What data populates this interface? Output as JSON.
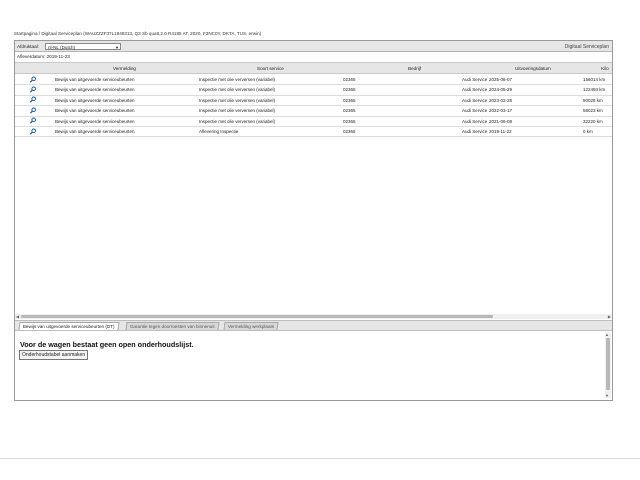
{
  "breadcrumb": "Startpagina / Digitaal Serviceplan (WAUZZZF37L1848313, Q3 Sb quatt,2.0 R4185 AT, 2020, F3NC0Y, DKTA, TUS, erwin)",
  "toolbar": {
    "language_label": "Afdruktaal:",
    "language_value": "nl-NL (Dutch)",
    "brand_label": "Digitaal Serviceplan"
  },
  "delivery_label": "Afleverdatum: 2019-11-23",
  "table": {
    "headers": [
      "Vermelding",
      "Soort service",
      "Bedrijf",
      "Uitvoeringsdatum",
      "Kilo"
    ],
    "rows": [
      {
        "icon": "magnifier-icon",
        "vermelding": "Bewijs van uitgevoerde serviceubeurten",
        "soort": "Inspectie met olie verversen (variabel)",
        "code": "02365",
        "bedrijf": "Audi Service",
        "datum": "2025-06-07",
        "km": "156014 km"
      },
      {
        "icon": "magnifier-icon",
        "vermelding": "Bewijs van uitgevoerde serviceubeurten",
        "soort": "Inspectie met olie verversen (variabel)",
        "code": "02365",
        "bedrijf": "Audi Service",
        "datum": "2024-05-29",
        "km": "122493 km"
      },
      {
        "icon": "magnifier-icon",
        "vermelding": "Bewijs van uitgevoerde serviceubeurten",
        "soort": "Inspectie met olie verversen (variabel)",
        "code": "02365",
        "bedrijf": "Audi Service",
        "datum": "2023-02-28",
        "km": "80028 km"
      },
      {
        "icon": "magnifier-icon",
        "vermelding": "Bewijs van uitgevoerde serviceubeurten",
        "soort": "Inspectie met olie verversen (variabel)",
        "code": "02365",
        "bedrijf": "Audi Service",
        "datum": "2022-03-17",
        "km": "58023 km"
      },
      {
        "icon": "magnifier-icon",
        "vermelding": "Bewijs van uitgevoerde serviceubeurten",
        "soort": "Inspectie met olie verversen (variabel)",
        "code": "02365",
        "bedrijf": "Audi Service",
        "datum": "2021-06-08",
        "km": "32220 km"
      },
      {
        "icon": "magnifier-icon",
        "vermelding": "Bewijs van uitgevoerde serviceubeurten",
        "soort": "Aflevering Inspectie",
        "code": "02365",
        "bedrijf": "Audi Service",
        "datum": "2019-11-22",
        "km": "0 km"
      }
    ]
  },
  "tabs": [
    {
      "label": "Bewijs van uitgevoerde serviceubeurten (DT)",
      "active": true
    },
    {
      "label": "Garantie tegen doorroesten van binnenuit",
      "active": false
    },
    {
      "label": "Vermelding werkplaats",
      "active": false
    }
  ],
  "panel": {
    "message": "Voor de wagen bestaat geen open onderhoudslijst.",
    "button_label": "Onderhoudstabel aanmaken"
  },
  "colors": {
    "accent_icon": "#1d5ea8",
    "toolbar_bg": "#e6e6e6"
  }
}
